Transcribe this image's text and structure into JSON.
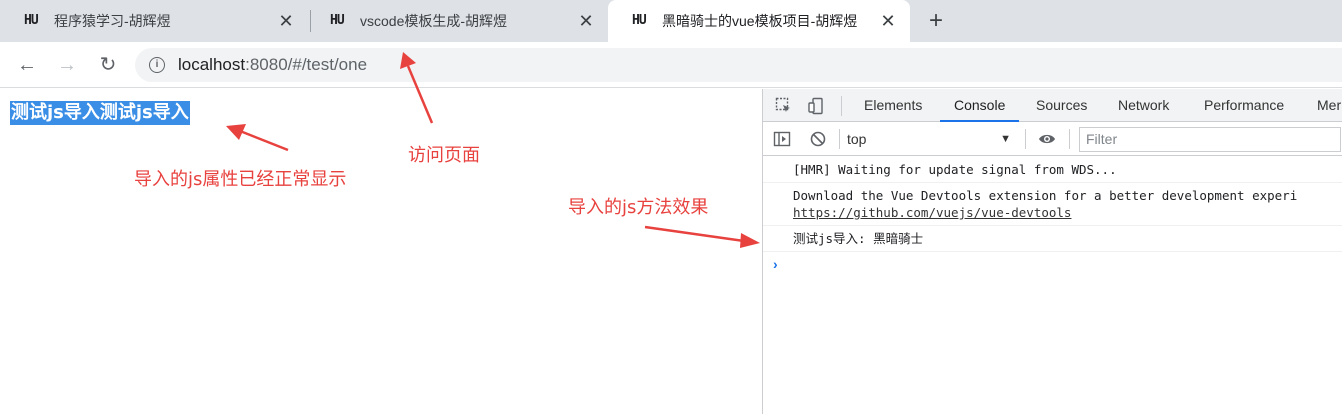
{
  "tabs": [
    {
      "favicon": "HU",
      "title": "程序猿学习-胡辉煜",
      "close": "✕"
    },
    {
      "favicon": "HU",
      "title": "vscode模板生成-胡辉煜",
      "close": "✕"
    },
    {
      "favicon": "HU",
      "title": "黑暗骑士的vue模板项目-胡辉煜",
      "close": "✕"
    }
  ],
  "new_tab": "+",
  "toolbar": {
    "back_icon": "←",
    "forward_icon": "→",
    "reload_icon": "↻",
    "info_icon": "i",
    "url_host": "localhost",
    "url_rest": ":8080/#/test/one"
  },
  "page": {
    "selected_text": "测试js导入测试js导入"
  },
  "devtools": {
    "tabs": [
      "Elements",
      "Console",
      "Sources",
      "Network",
      "Performance",
      "Mer"
    ],
    "active_tab": "Console",
    "context": "top",
    "filter_placeholder": "Filter",
    "console_lines": [
      "[HMR] Waiting for update signal from WDS...",
      "Download the Vue Devtools extension for a better development experi",
      "测试js导入:  黑暗骑士"
    ],
    "console_link": "https://github.com/vuejs/vue-devtools",
    "prompt": "›"
  },
  "annotations": {
    "page_note": "导入的js属性已经正常显示",
    "visit_note": "访问页面",
    "method_note": "导入的js方法效果"
  },
  "colors": {
    "annotation": "#e8423f",
    "selection": "#3a8ee6",
    "tabstrip": "#dee1e6",
    "accent": "#1a73e8"
  }
}
